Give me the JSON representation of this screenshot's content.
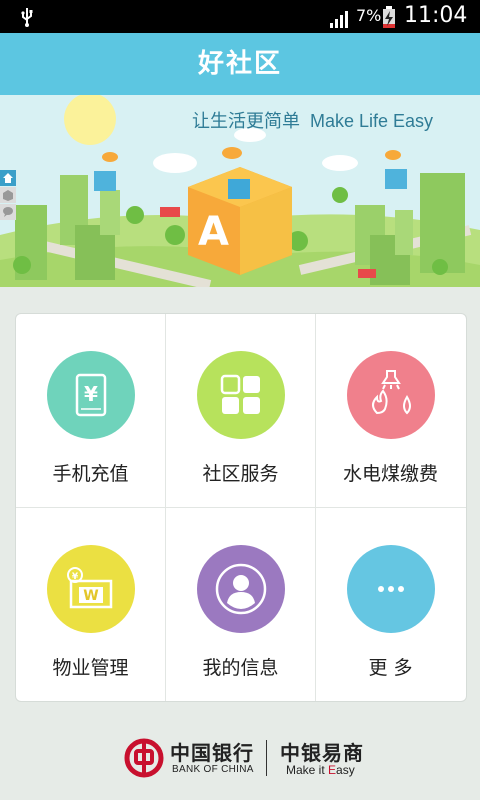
{
  "status_bar": {
    "battery_percent": "7%",
    "time": "11:04"
  },
  "app_bar": {
    "title": "好社区"
  },
  "banner": {
    "slogan_cn": "让生活更简单",
    "slogan_en": "Make Life Easy"
  },
  "menu": {
    "items": [
      {
        "label": "手机充值",
        "icon": "mobile-yuan-icon",
        "color": "#6fd3bb"
      },
      {
        "label": "社区服务",
        "icon": "grid-squares-icon",
        "color": "#b7e25c"
      },
      {
        "label": "水电煤缴费",
        "icon": "utilities-icon",
        "color": "#f0808c"
      },
      {
        "label": "物业管理",
        "icon": "property-card-icon",
        "color": "#ebe042"
      },
      {
        "label": "我的信息",
        "icon": "user-profile-icon",
        "color": "#9b79c0"
      },
      {
        "label": "更 多",
        "icon": "more-dots-icon",
        "color": "#65c6e2"
      }
    ]
  },
  "footer": {
    "bank_name_cn": "中国银行",
    "bank_name_en": "BANK OF CHINA",
    "product_cn": "中银易商",
    "product_en_prefix": "Make it ",
    "product_en_highlight": "E",
    "product_en_suffix": "asy"
  },
  "colors": {
    "app_bar": "#5cc6e1",
    "page_bg": "#e6ebe7",
    "boc_red": "#c8102e"
  }
}
